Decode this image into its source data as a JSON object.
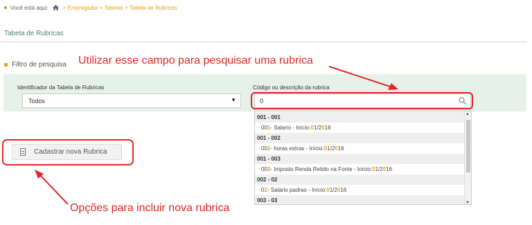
{
  "breadcrumb": {
    "prefix": "Você está aqui:",
    "home_icon": "home-icon",
    "path": "> Empregador > Tabelas > Tabela de Rubricas"
  },
  "page": {
    "title": "Tabela de Rubricas"
  },
  "filter": {
    "section_title": "Filtro de pesquisa",
    "identifier_label": "Identificador da Tabela de Rubricas",
    "identifier_value": "Todos",
    "search_label": "Código ou descrição da rubrica",
    "search_value": "0",
    "search_icon": "search-icon"
  },
  "dropdown": {
    "rows": [
      {
        "type": "group",
        "text": "001 - 001"
      },
      {
        "type": "item",
        "parts": [
          {
            "t": "00",
            "hl": false
          },
          {
            "t": "1",
            "hl": true
          },
          {
            "t": " - Salario - Início: ",
            "hl": false
          },
          {
            "t": "0",
            "hl": true
          },
          {
            "t": "1/2",
            "hl": false
          },
          {
            "t": "0",
            "hl": true
          },
          {
            "t": "16",
            "hl": false
          }
        ]
      },
      {
        "type": "group",
        "text": "001 - 002"
      },
      {
        "type": "item",
        "parts": [
          {
            "t": "00",
            "hl": false
          },
          {
            "t": "2",
            "hl": true
          },
          {
            "t": " - horas extras - Início: ",
            "hl": false
          },
          {
            "t": "0",
            "hl": true
          },
          {
            "t": "1/2",
            "hl": false
          },
          {
            "t": "0",
            "hl": true
          },
          {
            "t": "16",
            "hl": false
          }
        ]
      },
      {
        "type": "group",
        "text": "001 - 003"
      },
      {
        "type": "item",
        "parts": [
          {
            "t": "00",
            "hl": false
          },
          {
            "t": "3",
            "hl": true
          },
          {
            "t": " - Imposto Renda Retido na Fonte - Início: ",
            "hl": false
          },
          {
            "t": "0",
            "hl": true
          },
          {
            "t": "1/2",
            "hl": false
          },
          {
            "t": "0",
            "hl": true
          },
          {
            "t": "16",
            "hl": false
          }
        ]
      },
      {
        "type": "group",
        "text": "002 - 02"
      },
      {
        "type": "item",
        "parts": [
          {
            "t": "0",
            "hl": false
          },
          {
            "t": "2",
            "hl": true
          },
          {
            "t": " - Salario padrao - Início: ",
            "hl": false
          },
          {
            "t": "0",
            "hl": true
          },
          {
            "t": "1/2",
            "hl": false
          },
          {
            "t": "0",
            "hl": true
          },
          {
            "t": "16",
            "hl": false
          }
        ]
      },
      {
        "type": "group",
        "text": "003 - 03"
      }
    ]
  },
  "actions": {
    "new_button_label": "Cadastrar nova Rubrica",
    "new_button_icon": "document-icon"
  },
  "annotations": {
    "search_callout": "Utilizar esse campo para pesquisar uma rubrica",
    "button_callout": "Opções para incluir nova rubrica",
    "color": "#e3262a"
  },
  "colors": {
    "accent_orange": "#e8a21b",
    "title_green": "#4d8a6a",
    "panel_bg": "#e6f1ea"
  }
}
